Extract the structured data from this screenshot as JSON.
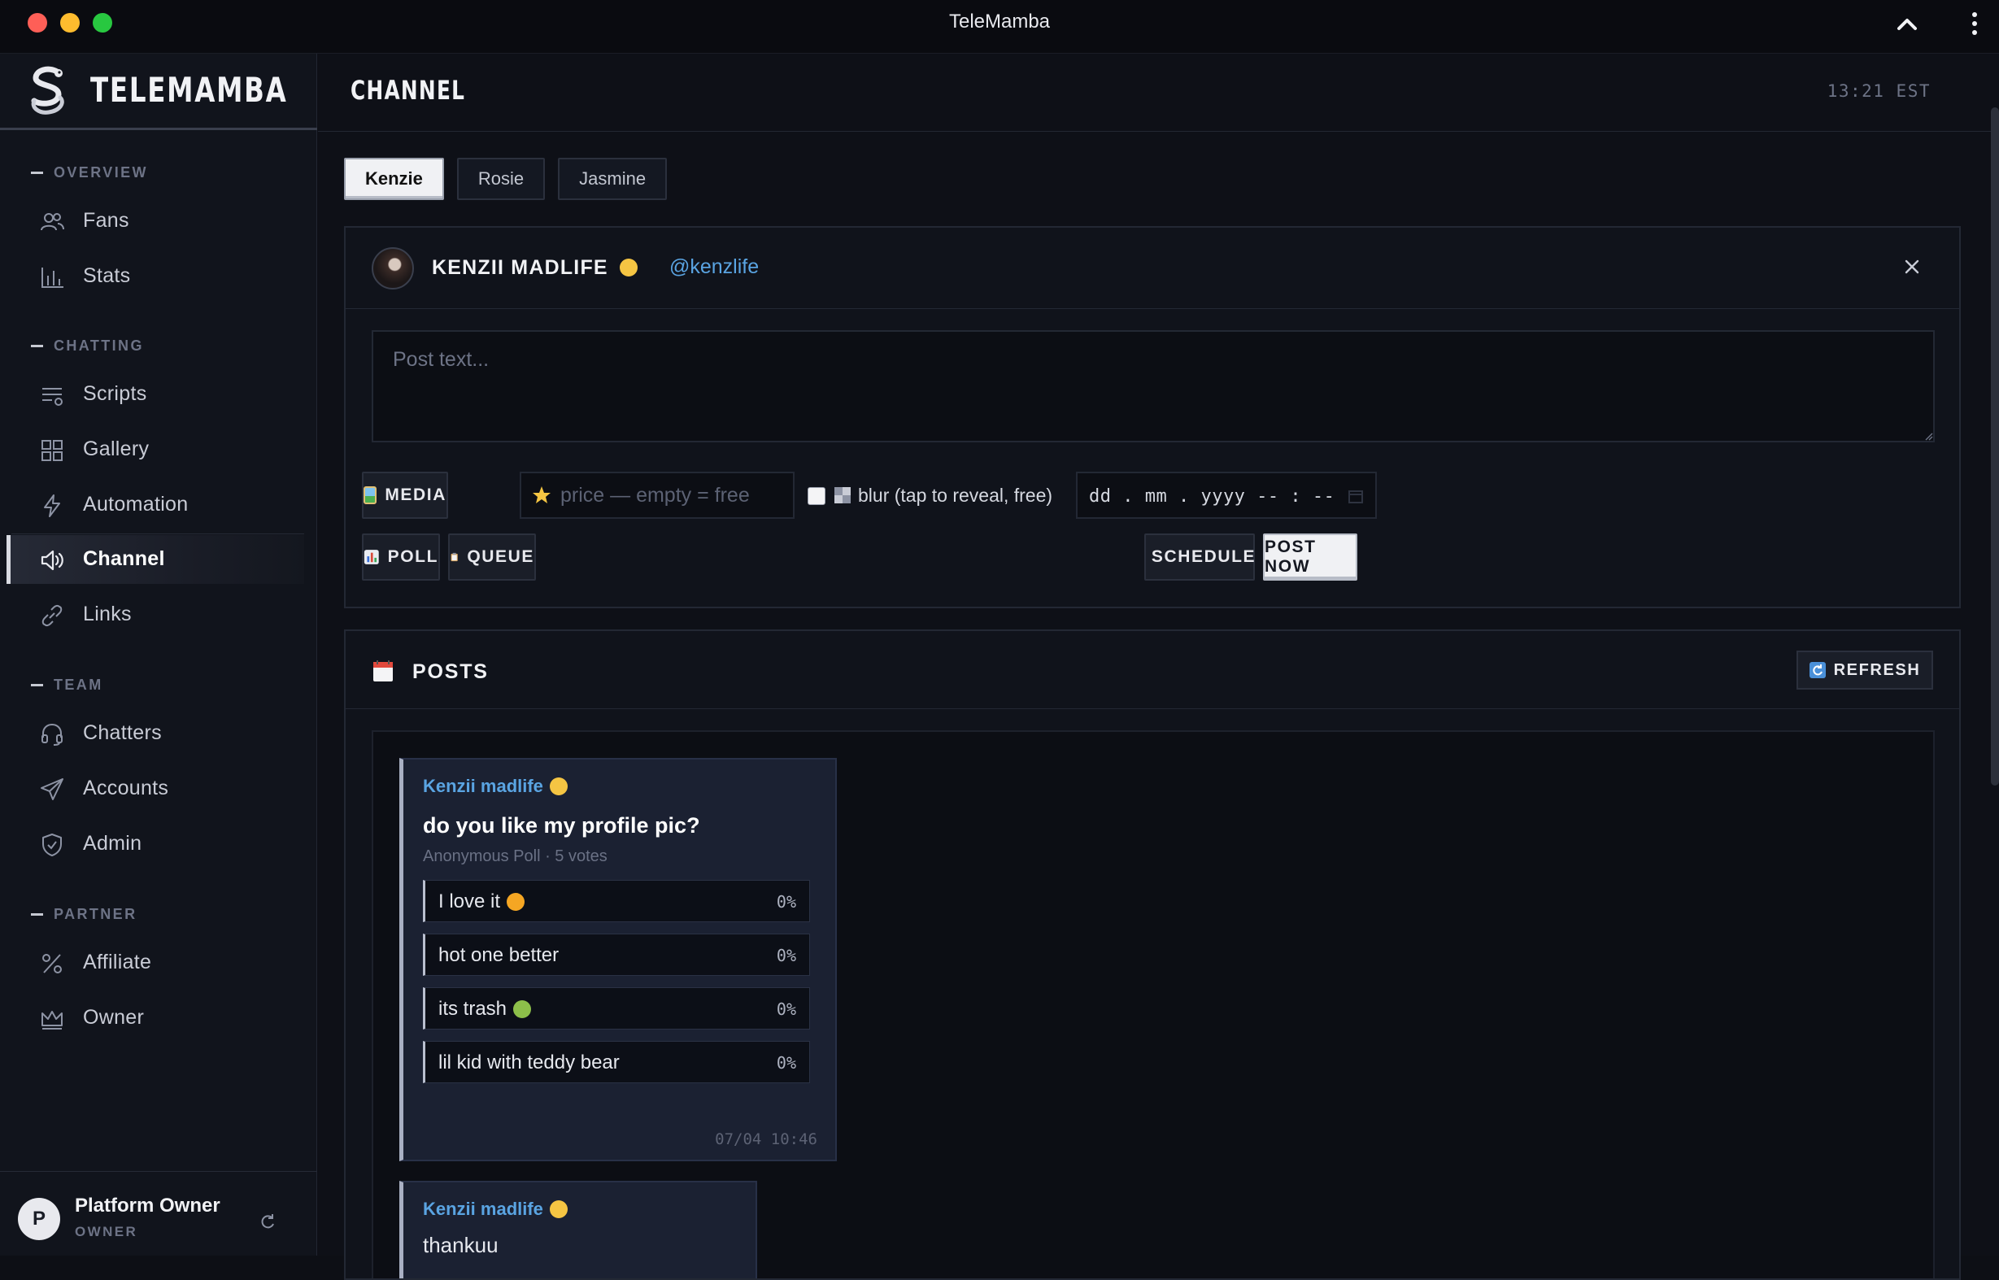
{
  "window": {
    "title": "TeleMamba"
  },
  "sidebar": {
    "brand": "TELEMAMBA",
    "sections": [
      {
        "title": "OVERVIEW",
        "items": [
          {
            "label": "Fans",
            "icon": "users-icon"
          },
          {
            "label": "Stats",
            "icon": "bar-chart-icon"
          }
        ]
      },
      {
        "title": "CHATTING",
        "items": [
          {
            "label": "Scripts",
            "icon": "list-icon"
          },
          {
            "label": "Gallery",
            "icon": "grid-icon"
          },
          {
            "label": "Automation",
            "icon": "lightning-icon"
          },
          {
            "label": "Channel",
            "icon": "megaphone-icon",
            "active": true
          },
          {
            "label": "Links",
            "icon": "link-icon"
          }
        ]
      },
      {
        "title": "TEAM",
        "items": [
          {
            "label": "Chatters",
            "icon": "headset-icon"
          },
          {
            "label": "Accounts",
            "icon": "send-icon"
          },
          {
            "label": "Admin",
            "icon": "shield-check-icon"
          }
        ]
      },
      {
        "title": "PARTNER",
        "items": [
          {
            "label": "Affiliate",
            "icon": "percent-icon"
          },
          {
            "label": "Owner",
            "icon": "crown-icon"
          }
        ]
      }
    ],
    "user": {
      "initial": "P",
      "name": "Platform Owner",
      "role": "OWNER"
    }
  },
  "header": {
    "title": "CHANNEL",
    "clock": "13:21 EST"
  },
  "tabs": [
    {
      "label": "Kenzie",
      "selected": true
    },
    {
      "label": "Rosie"
    },
    {
      "label": "Jasmine"
    }
  ],
  "composer": {
    "name": "KENZII MADLIFE",
    "handle": "@kenzlife",
    "placeholder": "Post text...",
    "media_label": "MEDIA",
    "price_placeholder": "price — empty = free",
    "blur_label": "blur (tap to reveal, free)",
    "blur_checked": false,
    "date_placeholder": "dd . mm . yyyy   -- : --",
    "poll_label": "POLL",
    "queue_label": "QUEUE",
    "schedule_label": "SCHEDULE",
    "post_now_label": "POST NOW"
  },
  "posts": {
    "title": "POSTS",
    "refresh_label": "REFRESH",
    "items": [
      {
        "author": "Kenzii madlife",
        "question": "do you like my profile pic?",
        "meta": "Anonymous Poll · 5 votes",
        "options": [
          {
            "label": "I love it",
            "pct": "0%",
            "emoji": "smiling-hearts-emoji"
          },
          {
            "label": "hot one better",
            "pct": "0%"
          },
          {
            "label": "its trash",
            "pct": "0%",
            "emoji": "nauseated-emoji"
          },
          {
            "label": "lil kid with teddy bear",
            "pct": "0%"
          }
        ],
        "time": "07/04 10:46"
      },
      {
        "author": "Kenzii madlife",
        "text": "thankuu"
      }
    ]
  },
  "colors": {
    "accent_link": "#5aa4e2",
    "background": "#0e1017",
    "sidebar": "#11141c"
  }
}
